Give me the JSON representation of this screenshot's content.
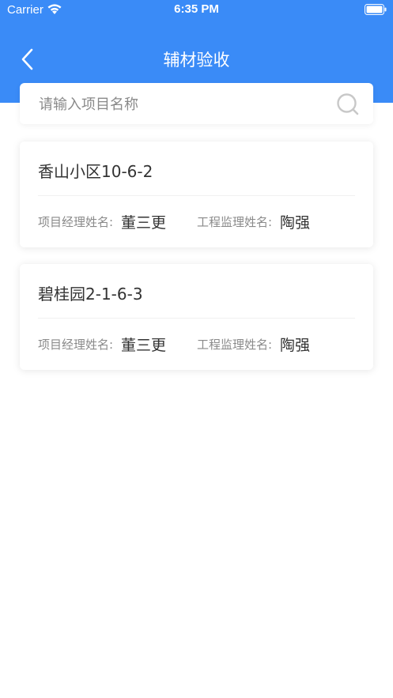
{
  "status_bar": {
    "carrier": "Carrier",
    "time": "6:35 PM",
    "wifi_icon": "wifi-icon",
    "battery_icon": "battery-icon"
  },
  "nav": {
    "title": "辅材验收",
    "back_icon": "chevron-left-icon"
  },
  "search": {
    "placeholder": "请输入项目名称",
    "value": "",
    "icon": "search-icon"
  },
  "projects": [
    {
      "name": "香山小区10-6-2",
      "manager_label": "项目经理姓名:",
      "manager": "董三更",
      "supervisor_label": "工程监理姓名:",
      "supervisor": "陶强"
    },
    {
      "name": "碧桂园2-1-6-3",
      "manager_label": "项目经理姓名:",
      "manager": "董三更",
      "supervisor_label": "工程监理姓名:",
      "supervisor": "陶强"
    }
  ],
  "colors": {
    "header": "#3a8bf7",
    "text_primary": "#333333",
    "text_secondary": "#8a8a8a",
    "background": "#ffffff"
  }
}
